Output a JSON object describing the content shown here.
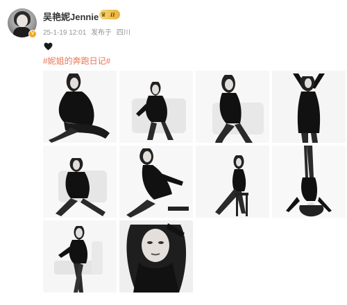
{
  "author": {
    "name": "吴艳妮Jennie",
    "member_level": "II",
    "verified_mark": "V",
    "avatar_icon": "avatar-photo"
  },
  "post": {
    "timestamp": "25-1-19 12:01",
    "source": "发布于",
    "location": "四川",
    "emoji": "heart-icon",
    "topic": "#妮姐的奔跑日记#"
  },
  "photos": [
    {
      "icon": "photo-seated-pose-1"
    },
    {
      "icon": "photo-chair-pose"
    },
    {
      "icon": "photo-seated-pose-2"
    },
    {
      "icon": "photo-standing-arms-up"
    },
    {
      "icon": "photo-floor-seated"
    },
    {
      "icon": "photo-stool-lean"
    },
    {
      "icon": "photo-high-stool"
    },
    {
      "icon": "photo-upside-down"
    },
    {
      "icon": "photo-chair-crossed-legs"
    },
    {
      "icon": "photo-portrait-closeup"
    }
  ],
  "colors": {
    "topic": "#eb7350",
    "meta": "#939393",
    "name": "#333333",
    "verified": "#f5a623"
  }
}
